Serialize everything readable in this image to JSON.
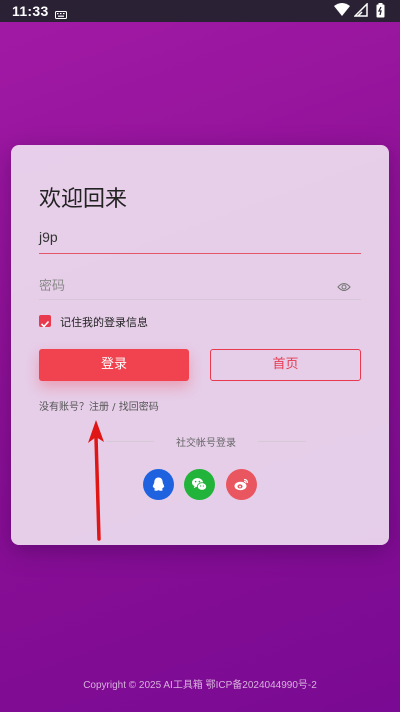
{
  "status_bar": {
    "time": "11:33"
  },
  "login": {
    "title": "欢迎回来",
    "username_value": "j9p",
    "password_placeholder": "密码",
    "remember_label": "记住我的登录信息",
    "remember_checked": true,
    "login_button": "登录",
    "home_button": "首页",
    "no_account_text": "没有账号？",
    "register_link": "注册",
    "separator": " / ",
    "forgot_link": "找回密码",
    "social_title": "社交帐号登录",
    "social_buttons": [
      "qq-icon",
      "wechat-icon",
      "weibo-icon"
    ]
  },
  "footer": {
    "copyright": "Copyright © 2025 AI工具箱 鄂ICP备2024044990号-2"
  },
  "colors": {
    "accent": "#f0434f",
    "background": "#8e1096",
    "qq": "#1e62e0",
    "wechat": "#21b33a",
    "weibo": "#e9565f"
  }
}
